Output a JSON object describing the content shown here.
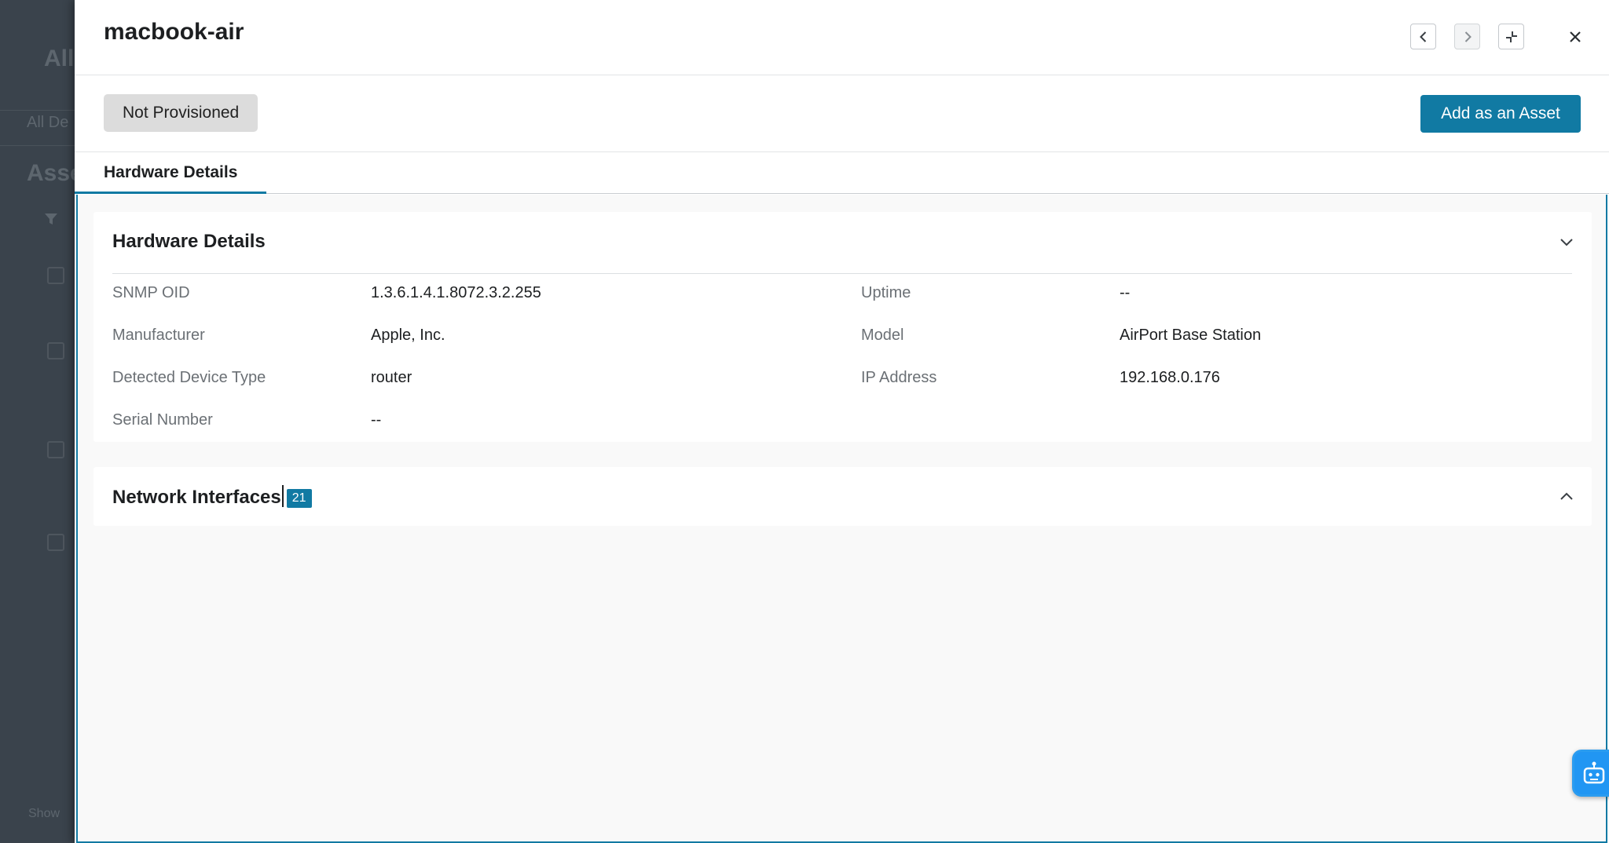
{
  "background": {
    "page_title": "All",
    "tab_label": "All De",
    "section_title": "Asse",
    "footer_text": "Show"
  },
  "drawer": {
    "title": "macbook-air",
    "nav": {
      "prev_icon": "chevron-left-icon",
      "next_icon": "chevron-right-icon",
      "collapse_icon": "collapse-icon",
      "close_icon": "close-icon"
    },
    "status": "Not Provisioned",
    "primary_action": "Add as an Asset",
    "tabs": [
      {
        "label": "Hardware Details",
        "active": true
      }
    ]
  },
  "hardware_details": {
    "title": "Hardware Details",
    "expanded": true,
    "fields": [
      {
        "label": "SNMP OID",
        "value": "1.3.6.1.4.1.8072.3.2.255"
      },
      {
        "label": "Uptime",
        "value": "--"
      },
      {
        "label": "Manufacturer",
        "value": "Apple, Inc."
      },
      {
        "label": "Model",
        "value": "AirPort Base Station"
      },
      {
        "label": "Detected Device Type",
        "value": "router"
      },
      {
        "label": "IP Address",
        "value": "192.168.0.176"
      },
      {
        "label": "Serial Number",
        "value": "--"
      }
    ]
  },
  "network_interfaces": {
    "title": "Network Interfaces",
    "count": "21",
    "expanded": false
  },
  "assistant": {
    "icon": "robot-icon"
  },
  "colors": {
    "accent": "#117aa3",
    "status_pill": "#dcdcdc",
    "backdrop": "#3a434c"
  }
}
